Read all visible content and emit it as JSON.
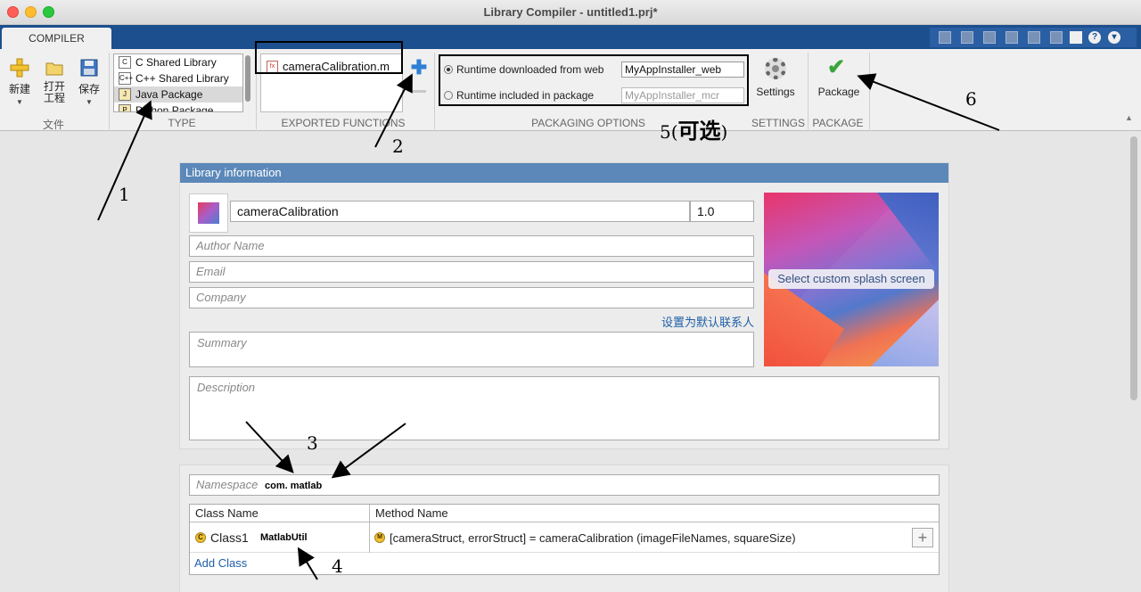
{
  "window": {
    "title": "Library Compiler - untitled1.prj*"
  },
  "tabs": {
    "compiler": "COMPILER"
  },
  "toolbar": {
    "file": {
      "new_label": "新建",
      "open_label": "打开\n工程",
      "save_label": "保存",
      "section_label": "文件"
    },
    "type": {
      "items": [
        "C Shared Library",
        "C++ Shared Library",
        "Java Package",
        "Python Package"
      ],
      "selected": "Java Package",
      "section_label": "TYPE"
    },
    "exported": {
      "file": "cameraCalibration.m",
      "section_label": "EXPORTED FUNCTIONS"
    },
    "packaging": {
      "web_label": "Runtime downloaded from web",
      "web_value": "MyAppInstaller_web",
      "pkg_label": "Runtime included in package",
      "pkg_value": "MyAppInstaller_mcr",
      "section_label": "PACKAGING OPTIONS"
    },
    "settings": {
      "label": "Settings",
      "section_label": "SETTINGS"
    },
    "package": {
      "label": "Package",
      "section_label": "PACKAGE"
    }
  },
  "library_info": {
    "header": "Library information",
    "name": "cameraCalibration",
    "version": "1.0",
    "author_placeholder": "Author Name",
    "email_placeholder": "Email",
    "company_placeholder": "Company",
    "default_contact_link": "设置为默认联系人",
    "summary_placeholder": "Summary",
    "description_placeholder": "Description",
    "splash_button": "Select custom splash screen"
  },
  "namespace": {
    "placeholder": "Namespace",
    "value": "com. matlab"
  },
  "classes": {
    "col_class": "Class Name",
    "col_method": "Method Name",
    "rows": [
      {
        "class_name": "Class1",
        "overlay_name": "MatlabUtil",
        "method": "[cameraStruct, errorStruct] = cameraCalibration (imageFileNames, squareSize)"
      }
    ],
    "add_class": "Add Class"
  },
  "annotations": {
    "n1": "1",
    "n2": "2",
    "n3": "3",
    "n4": "4",
    "n5": "5(",
    "n5_text": "可选",
    "n5_close": ")",
    "n6": "6"
  }
}
